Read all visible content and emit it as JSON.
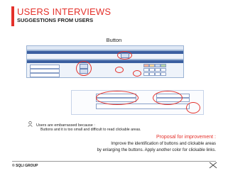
{
  "header": {
    "title": "USERS INTERVIEWS",
    "subtitle": "SUGGESTIONS FROM USERS"
  },
  "section": {
    "title": "Button"
  },
  "notes": {
    "line1": "Users are embarrassed because :",
    "line2": "Buttons and it is too small and difficult to read clickable areas."
  },
  "proposal": {
    "title": "Proposal for improvement :",
    "line1": "Improve the identification of buttons and clickable areas",
    "line2": "by enlarging the buttons. Apply another color for clickable links."
  },
  "footer": {
    "text": "© SQLI GROUP"
  },
  "colors": {
    "accent": "#e4312b",
    "panel_header": "#3b5fa0"
  }
}
